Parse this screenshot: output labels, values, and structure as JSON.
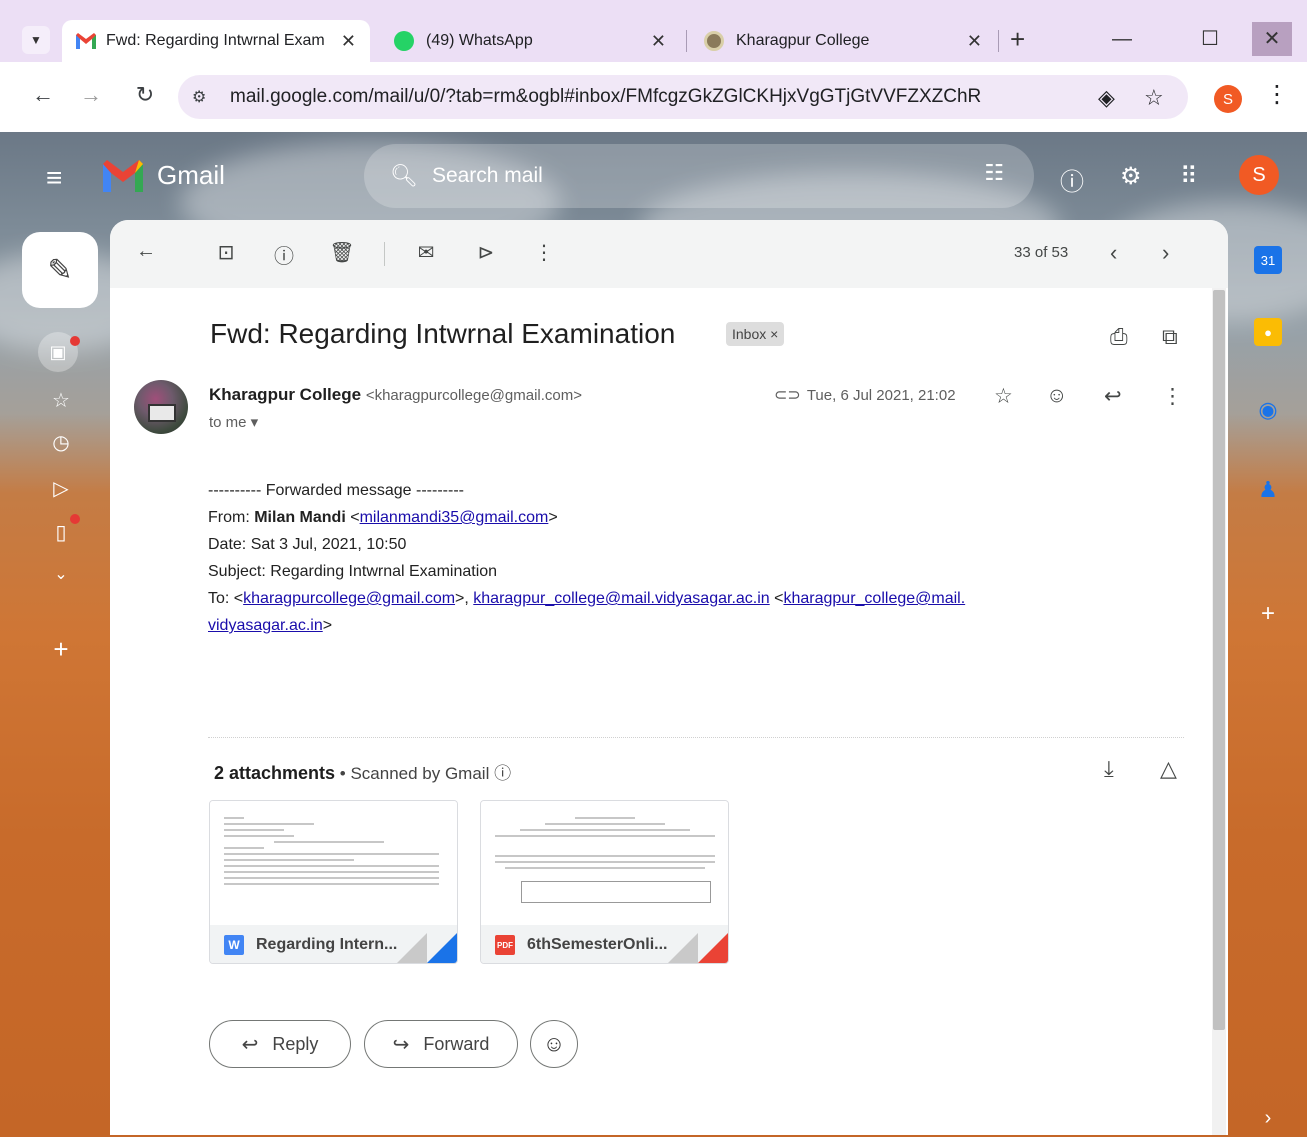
{
  "browser": {
    "tabs": [
      {
        "title": "Fwd: Regarding Intwrnal Exam",
        "close": "✕"
      },
      {
        "title": "(49) WhatsApp",
        "close": "✕"
      },
      {
        "title": "Kharagpur College",
        "close": "✕"
      }
    ],
    "new_tab": "+",
    "url": "mail.google.com/mail/u/0/?tab=rm&ogbl#inbox/FMfcgzGkZGlCKHjxVgGTjGtVVFZXZChR",
    "profile_initial": "S"
  },
  "gmail": {
    "brand": "Gmail",
    "search_placeholder": "Search mail",
    "avatar_initial": "S"
  },
  "toolbar": {
    "pager": "33 of 53"
  },
  "email": {
    "subject": "Fwd: Regarding Intwrnal Examination",
    "label": "Inbox ×",
    "sender_name": "Kharagpur College",
    "sender_addr": "<kharagpurcollege@gmail.com>",
    "to": "to me ▾",
    "date": "Tue, 6 Jul 2021, 21:02",
    "body": {
      "forwarded": "---------- Forwarded message ---------",
      "from_label": "From: ",
      "from_name": "Milan Mandi",
      "from_lt": " <",
      "from_email": "milanmandi35@gmail.com",
      "from_gt": ">",
      "date_line": "Date: Sat 3 Jul, 2021, 10:50",
      "subject_line": "Subject: Regarding Intwrnal Examination",
      "to_label": "To: <",
      "to_email1": "kharagpurcollege@gmail.com",
      "to_sep": ">, ",
      "to_email2": "kharagpur_college@mail.vidyasagar.ac.in",
      "to_lt": " <",
      "to_email3a": "kharagpur_college@mail.",
      "to_email3b": "vidyasagar.ac.in",
      "to_gt": ">"
    }
  },
  "attachments": {
    "count_label": "2 attachments",
    "scanned": " • Scanned by Gmail ⓘ",
    "items": [
      {
        "name": "Regarding Intern...",
        "badge": "W",
        "color": "#4285f4"
      },
      {
        "name": "6thSemesterOnli...",
        "badge": "PDF",
        "color": "#ea4335"
      }
    ]
  },
  "actions": {
    "reply": "Reply",
    "forward": "Forward"
  }
}
